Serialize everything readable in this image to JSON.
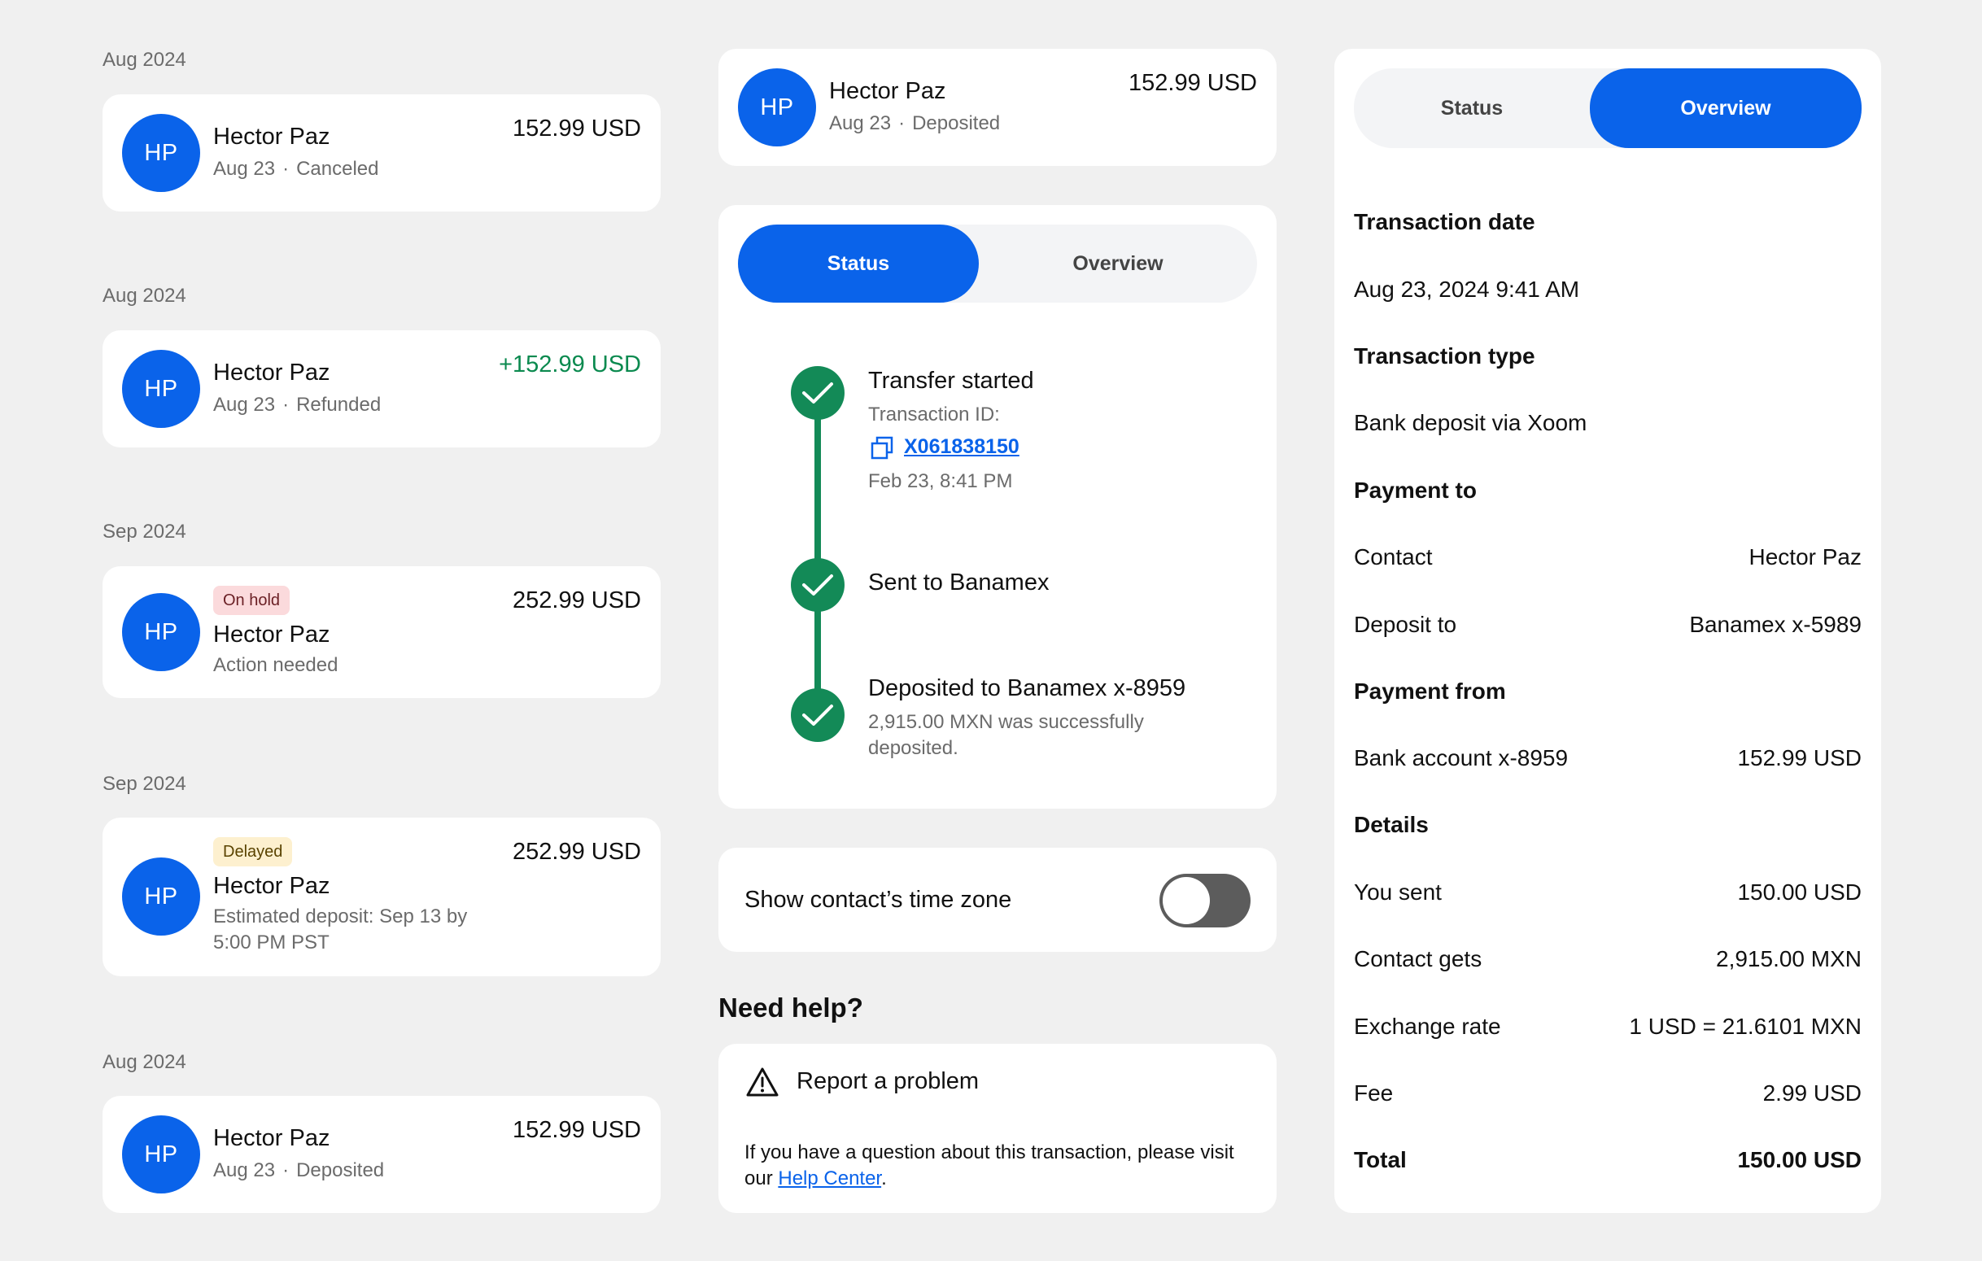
{
  "transactions": [
    {
      "month": "Aug 2024",
      "initials": "HP",
      "name": "Hector Paz",
      "date": "Aug 23",
      "status": "Canceled",
      "amount": "152.99 USD"
    },
    {
      "month": "Aug 2024",
      "initials": "HP",
      "name": "Hector Paz",
      "date": "Aug 23",
      "status": "Refunded",
      "amount": "+152.99 USD"
    },
    {
      "month": "Sep 2024",
      "initials": "HP",
      "badge": "On hold",
      "name": "Hector Paz",
      "note": "Action needed",
      "amount": "252.99 USD"
    },
    {
      "month": "Sep 2024",
      "initials": "HP",
      "badge": "Delayed",
      "name": "Hector Paz",
      "note_line1": "Estimated deposit: Sep 13 by",
      "note_line2": "5:00 PM PST",
      "amount": "252.99 USD"
    },
    {
      "month": "Aug 2024",
      "initials": "HP",
      "name": "Hector Paz",
      "date": "Aug 23",
      "status": "Deposited",
      "amount": "152.99 USD"
    }
  ],
  "detail_header": {
    "initials": "HP",
    "name": "Hector Paz",
    "date": "Aug 23",
    "status": "Deposited",
    "amount": "152.99 USD"
  },
  "status_tabs": {
    "status": "Status",
    "overview": "Overview"
  },
  "timeline": {
    "step1_title": "Transfer started",
    "step1_id_label": "Transaction ID:",
    "step1_id_value": "X061838150",
    "step1_time": "Feb 23, 8:41 PM",
    "step2_title": "Sent to Banamex",
    "step3_title": "Deposited to Banamex x-8959",
    "step3_line1": "2,915.00 MXN was successfully",
    "step3_line2": "deposited."
  },
  "timezone": {
    "label": "Show contact’s time zone",
    "enabled": false
  },
  "help": {
    "heading": "Need help?",
    "report_label": "Report a problem",
    "body_line1": "If you have a question about this transaction, please visit",
    "body_prefix": "our ",
    "link_text": "Help Center",
    "body_suffix": "."
  },
  "overview": {
    "tab_status": "Status",
    "tab_overview": "Overview",
    "transaction_date_head": "Transaction date",
    "transaction_date": "Aug 23, 2024 9:41 AM",
    "transaction_type_head": "Transaction type",
    "transaction_type": "Bank deposit via Xoom",
    "payment_to_head": "Payment to",
    "contact_label": "Contact",
    "contact_value": "Hector Paz",
    "deposit_label": "Deposit to",
    "deposit_value": "Banamex x-5989",
    "payment_from_head": "Payment from",
    "bank_label": "Bank account x-8959",
    "bank_value": "152.99 USD",
    "details_head": "Details",
    "sent_label": "You sent",
    "sent_value": "150.00 USD",
    "gets_label": "Contact gets",
    "gets_value": "2,915.00 MXN",
    "rate_label": "Exchange rate",
    "rate_value": "1 USD = 21.6101 MXN",
    "fee_label": "Fee",
    "fee_value": "2.99 USD",
    "total_label": "Total",
    "total_value": "150.00 USD"
  },
  "colors": {
    "brand": "#0a63ea",
    "success": "#138a57",
    "positive_amount": "#0b8a4f",
    "background": "#f0f0f0"
  }
}
